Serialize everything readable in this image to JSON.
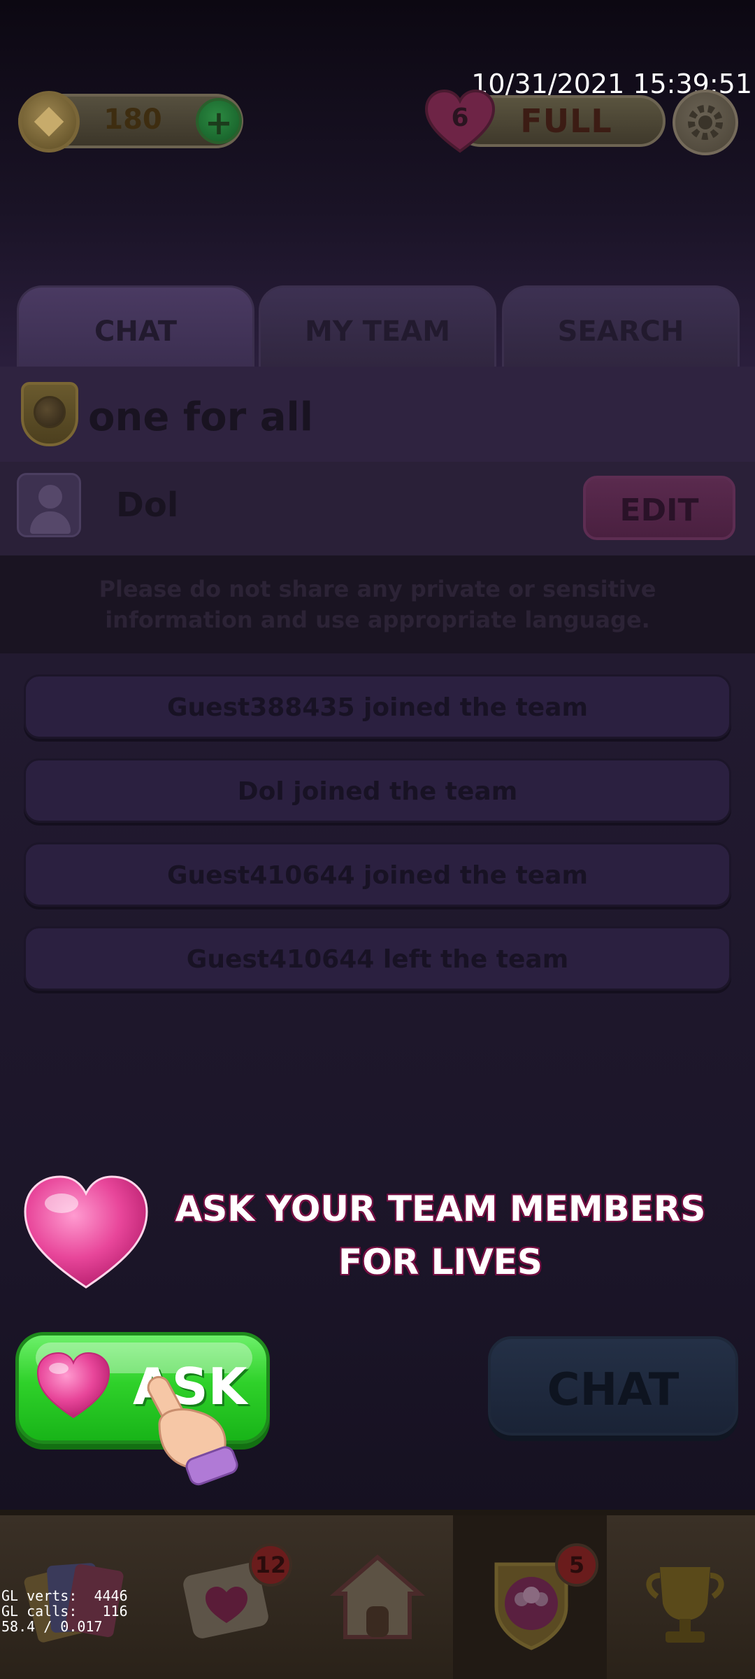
{
  "timestamp": "10/31/2021 15:39:51",
  "top_bar": {
    "coins": "180",
    "coin_icon": "coin-icon",
    "add_coins_icon": "plus-icon",
    "lives_count": "6",
    "lives_status": "FULL",
    "settings_icon": "gear-icon"
  },
  "tabs": [
    {
      "label": "CHAT",
      "active": true
    },
    {
      "label": "MY TEAM",
      "active": false
    },
    {
      "label": "SEARCH",
      "active": false
    }
  ],
  "team": {
    "name": "one for all",
    "player_name": "Dol",
    "edit_label": "EDIT"
  },
  "notice": "Please do not share any private or sensitive information and use appropriate language.",
  "messages": [
    "Guest388435 joined the team",
    "Dol joined the team",
    "Guest410644 joined the team",
    "Guest410644 left the team"
  ],
  "tutorial": {
    "line1": "ASK YOUR TEAM MEMBERS",
    "line2": "FOR LIVES",
    "ask_label": "ASK",
    "chat_label": "CHAT"
  },
  "bottom_nav": {
    "items": [
      {
        "icon": "cards-icon"
      },
      {
        "icon": "mail-heart-icon",
        "badge": "12"
      },
      {
        "icon": "home-icon"
      },
      {
        "icon": "team-icon",
        "badge": "5",
        "active": true
      },
      {
        "icon": "trophy-icon"
      }
    ]
  },
  "debug": {
    "line1": "GL verts:  4446",
    "line2": "GL calls:   116",
    "line3": "58.4 / 0.017"
  },
  "colors": {
    "ask_green": "#2fd12a",
    "heart_pink": "#e8469a",
    "overlay_purple": "#2a1e3c"
  }
}
